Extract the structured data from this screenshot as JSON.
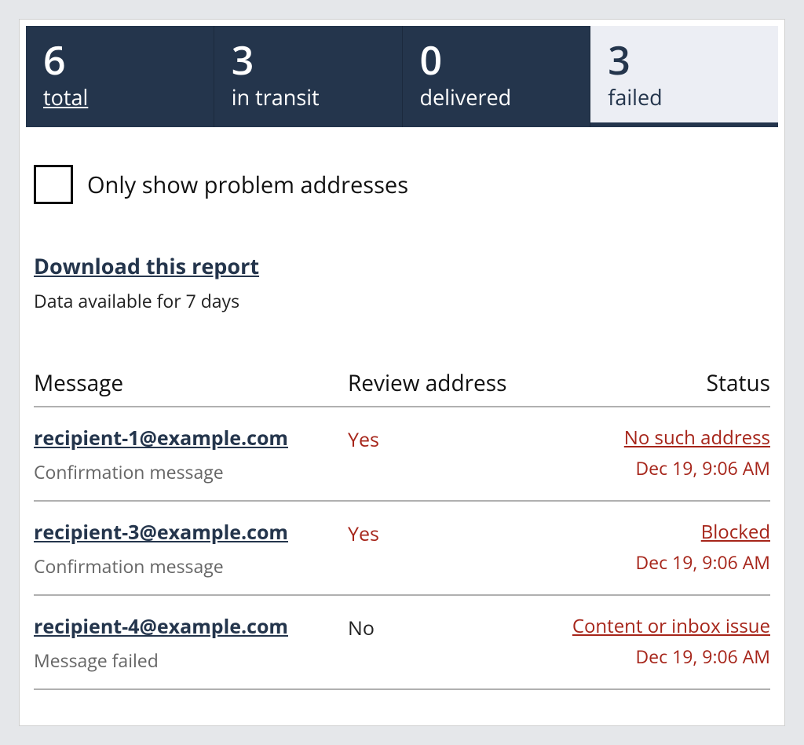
{
  "banner": {
    "total": {
      "count": "6",
      "label": "total"
    },
    "in_transit": {
      "count": "3",
      "label": "in transit"
    },
    "delivered": {
      "count": "0",
      "label": "delivered"
    },
    "failed": {
      "count": "3",
      "label": "failed"
    }
  },
  "filter": {
    "checkbox_label": "Only show problem addresses"
  },
  "download": {
    "link": "Download this report",
    "hint": "Data available for 7 days"
  },
  "table": {
    "headers": {
      "message": "Message",
      "review": "Review address",
      "status": "Status"
    },
    "rows": [
      {
        "recipient": "recipient-1@example.com",
        "subtext": "Confirmation message",
        "review": "Yes",
        "review_style": "yes",
        "status": "No such address",
        "time": "Dec 19, 9:06 AM"
      },
      {
        "recipient": "recipient-3@example.com",
        "subtext": "Confirmation message",
        "review": "Yes",
        "review_style": "yes",
        "status": "Blocked",
        "time": "Dec 19, 9:06 AM"
      },
      {
        "recipient": "recipient-4@example.com",
        "subtext": "Message failed",
        "review": "No",
        "review_style": "no",
        "status": "Content or inbox issue",
        "time": "Dec 19, 9:06 AM"
      }
    ]
  }
}
